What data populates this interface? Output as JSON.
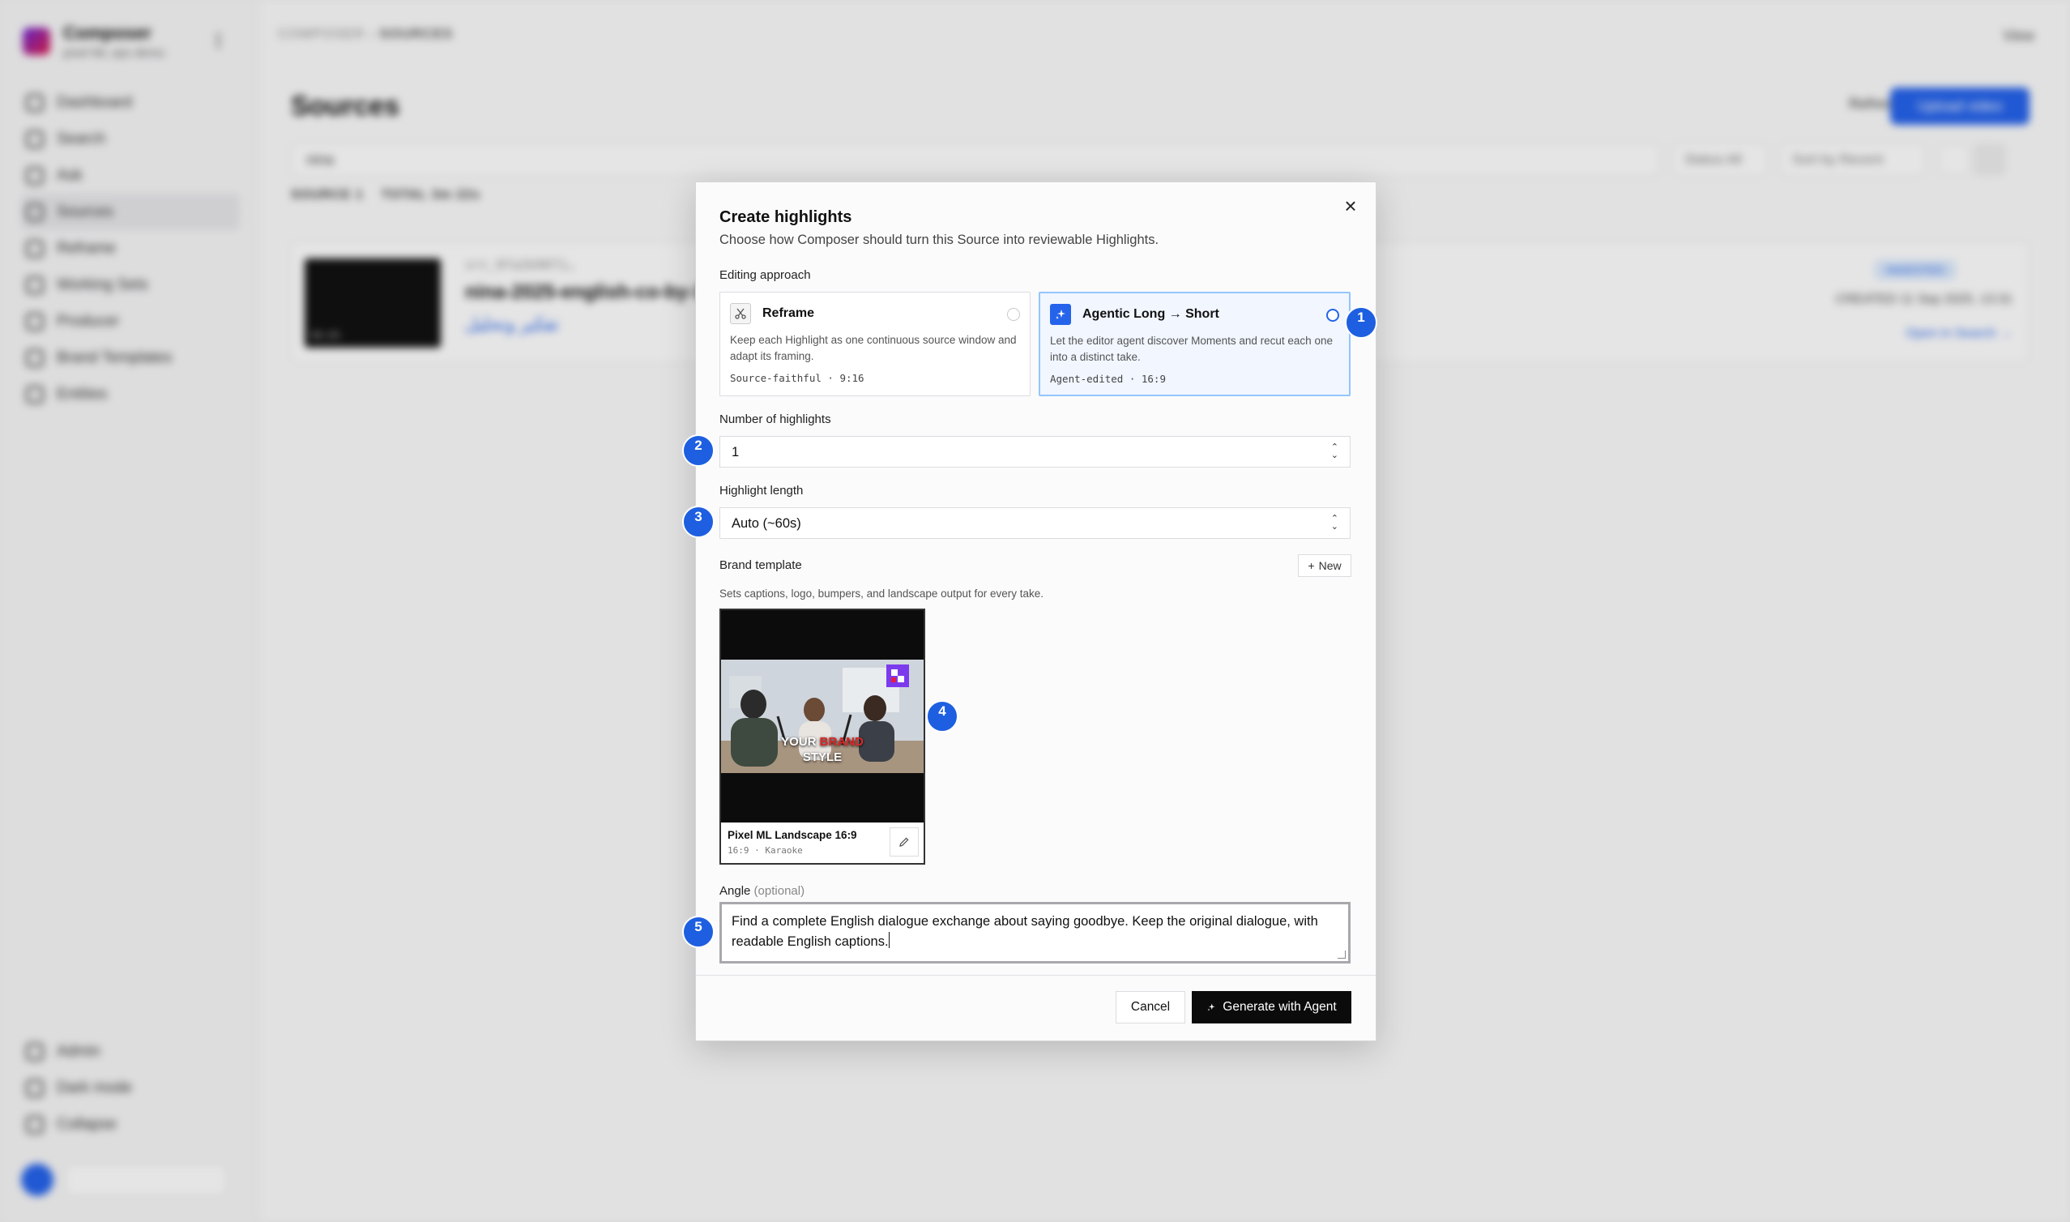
{
  "app": {
    "workspace_name": "Composer",
    "workspace_sub": "pixel ML ops demo",
    "nav": [
      "Dashboard",
      "Search",
      "Ask",
      "Sources",
      "Reframe",
      "Working Sets",
      "Producer",
      "Brand Templates",
      "Entities"
    ],
    "nav_active": "Sources",
    "nav_bottom": [
      "Admin",
      "Dark mode",
      "Collapse"
    ],
    "breadcrumb_root": "COMPOSER",
    "breadcrumb_current": "SOURCES",
    "view_label": "View",
    "page_title": "Sources",
    "refresh_label": "Refresh",
    "upload_label": "Upload video",
    "search_value": "nina",
    "status_filter": "Status All",
    "sort_filter": "Sort by Recent",
    "stats_sources": "SOURCE 1",
    "stats_total": "TOTAL 3m 22s",
    "source_id": "src_8fa2b9071…",
    "source_title": "nina-2025-english-co-by-3…",
    "source_arabic": "تفكير وتحليل",
    "source_badge": "INGESTED",
    "source_date": "CREATED 11 Sep 2025, 13:31",
    "source_link": "Open in Search →",
    "thumb_time": "00:05"
  },
  "modal": {
    "title": "Create highlights",
    "subtitle": "Choose how Composer should turn this Source into reviewable Highlights.",
    "editing_label": "Editing approach",
    "approaches": [
      {
        "name": "Reframe",
        "desc": "Keep each Highlight as one continuous source window and adapt its framing.",
        "meta": "Source-faithful · 9:16",
        "icon": "scissors-icon"
      },
      {
        "name": "Agentic Long → Short",
        "desc": "Let the editor agent discover Moments and recut each one into a distinct take.",
        "meta": "Agent-edited · 16:9",
        "icon": "sparkles-icon"
      }
    ],
    "count_label": "Number of highlights",
    "count_value": "1",
    "length_label": "Highlight length",
    "length_value": "Auto (~60s)",
    "brand_label": "Brand template",
    "new_label": "New",
    "brand_hint": "Sets captions, logo, bumpers, and landscape output for every take.",
    "template": {
      "name": "Pixel ML Landscape 16:9",
      "meta": "16:9 · Karaoke",
      "overlay_line1_a": "YOUR",
      "overlay_line1_b": "BRAND",
      "overlay_line2": "STYLE"
    },
    "angle_label": "Angle",
    "angle_optional": "(optional)",
    "angle_value": "Find a complete English dialogue exchange about saying goodbye. Keep the original dialogue, with readable English captions.",
    "cancel_label": "Cancel",
    "generate_label": "Generate with Agent"
  },
  "steps": [
    "1",
    "2",
    "3",
    "4",
    "5"
  ],
  "colors": {
    "accent": "#2563eb",
    "step_marker": "#1d5fe0",
    "primary_button": "#0b0b0c",
    "selected_border": "#93c5fd",
    "brand_text": "#dc2626"
  }
}
